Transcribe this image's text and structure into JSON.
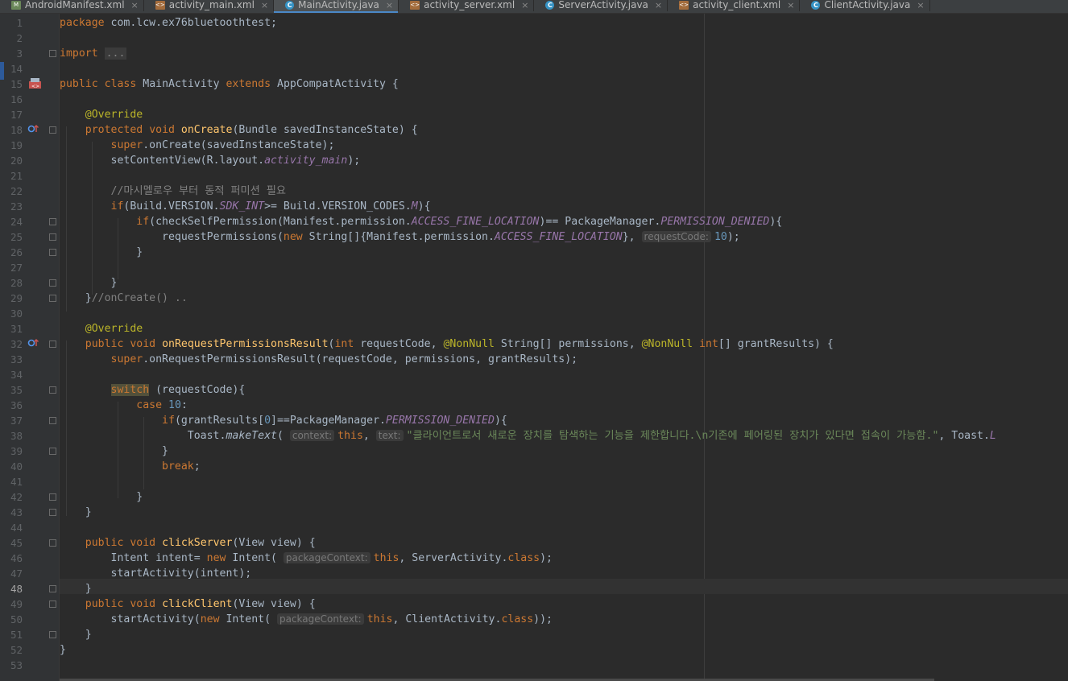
{
  "tabs": [
    {
      "label": "AndroidManifest.xml",
      "icon": "manifest-file-icon",
      "active": false
    },
    {
      "label": "activity_main.xml",
      "icon": "xml-file-icon",
      "active": false
    },
    {
      "label": "MainActivity.java",
      "icon": "java-class-icon",
      "active": true
    },
    {
      "label": "activity_server.xml",
      "icon": "xml-file-icon",
      "active": false
    },
    {
      "label": "ServerActivity.java",
      "icon": "java-class-icon",
      "active": false
    },
    {
      "label": "activity_client.xml",
      "icon": "xml-file-icon",
      "active": false
    },
    {
      "label": "ClientActivity.java",
      "icon": "java-class-icon",
      "active": false
    }
  ],
  "tab_close_glyph": "×",
  "current_line": "48",
  "code": {
    "l1": {
      "kw": "package",
      "rest": " com.lcw.ex76bluetoothtest;"
    },
    "l3": {
      "kw": "import",
      "fold": "..."
    },
    "l15": {
      "kw1": "public",
      "kw2": "class",
      "name": "MainActivity",
      "kw3": "extends",
      "rest": "AppCompatActivity {"
    },
    "l17": {
      "ann": "@Override"
    },
    "l18": {
      "kw1": "protected",
      "kw2": "void",
      "fn": "onCreate",
      "rest": "(Bundle savedInstanceState) {"
    },
    "l19": {
      "kw": "super",
      "rest": ".onCreate(savedInstanceState);"
    },
    "l20": {
      "pre": "setContentView(R.layout.",
      "field": "activity_main",
      "post": ");"
    },
    "l22": {
      "comment": "//마시멜로우 부터 동적 퍼미션 필요"
    },
    "l23": {
      "kw": "if",
      "pre": "(Build.VERSION.",
      "field": "SDK_INT",
      "mid": ">= Build.VERSION_CODES.",
      "field2": "M",
      "post": "){"
    },
    "l24": {
      "kw": "if",
      "pre": "(checkSelfPermission(Manifest.permission.",
      "field": "ACCESS_FINE_LOCATION",
      "mid": ")== PackageManager.",
      "field2": "PERMISSION_DENIED",
      "post": "){"
    },
    "l25": {
      "pre": "requestPermissions(",
      "kw": "new",
      "mid": " String[]{Manifest.permission.",
      "field": "ACCESS_FINE_LOCATION",
      "mid2": "}, ",
      "hint": "requestCode:",
      "num": "10",
      "post": ");"
    },
    "l26": {
      "text": "}"
    },
    "l28": {
      "text": "}"
    },
    "l29": {
      "brace": "}",
      "comment": "//onCreate() .."
    },
    "l31": {
      "ann": "@Override"
    },
    "l32": {
      "kw1": "public",
      "kw2": "void",
      "fn": "onRequestPermissionsResult",
      "p1": "(",
      "kw3": "int",
      "p2": " requestCode, ",
      "ann1": "@NonNull",
      "p3": " String[] permissions, ",
      "ann2": "@NonNull",
      "kw4": "int",
      "p4": "[] grantResults) {"
    },
    "l33": {
      "kw": "super",
      "rest": ".onRequestPermissionsResult(requestCode, permissions, grantResults);"
    },
    "l35": {
      "kw": "switch",
      "rest": " (requestCode){"
    },
    "l36": {
      "kw": "case",
      "num": "10",
      "post": ":"
    },
    "l37": {
      "kw": "if",
      "pre": "(grantResults[",
      "num": "0",
      "mid": "]==PackageManager.",
      "field": "PERMISSION_DENIED",
      "post": "){"
    },
    "l38": {
      "pre": "Toast.",
      "fn": "makeText",
      "p1": "( ",
      "hint1": "context:",
      "kw": "this",
      "p2": ", ",
      "hint2": "text:",
      "str": "\"클라이언트로서 새로운 장치를 탐색하는 기능을 제한합니다.\\n기존에 페어링된 장치가 있다면 접속이 가능함.\"",
      "post": ", Toast.",
      "tail": "L"
    },
    "l39": {
      "text": "}"
    },
    "l40": {
      "kw": "break",
      "post": ";"
    },
    "l42": {
      "text": "}"
    },
    "l43": {
      "text": "}"
    },
    "l45": {
      "kw1": "public",
      "kw2": "void",
      "fn": "clickServer",
      "rest": "(View view) {"
    },
    "l46": {
      "pre": "Intent intent= ",
      "kw": "new",
      "mid": " Intent( ",
      "hint": "packageContext:",
      "kw2": "this",
      "mid2": ", ServerActivity.",
      "kw3": "class",
      "post": ");"
    },
    "l47": {
      "text": "startActivity(intent);"
    },
    "l48": {
      "text": "}"
    },
    "l49": {
      "kw1": "public",
      "kw2": "void",
      "fn": "clickClient",
      "rest": "(View view) {"
    },
    "l50": {
      "pre": "startActivity(",
      "kw": "new",
      "mid": " Intent( ",
      "hint": "packageContext:",
      "kw2": "this",
      "mid2": ", ClientActivity.",
      "kw3": "class",
      "post": "));"
    },
    "l51": {
      "text": "}"
    },
    "l52": {
      "text": "}"
    }
  },
  "line_numbers": [
    "1",
    "2",
    "3",
    "14",
    "15",
    "16",
    "17",
    "18",
    "19",
    "20",
    "21",
    "22",
    "23",
    "24",
    "25",
    "26",
    "27",
    "28",
    "29",
    "30",
    "31",
    "32",
    "33",
    "34",
    "35",
    "36",
    "37",
    "38",
    "39",
    "40",
    "41",
    "42",
    "43",
    "44",
    "45",
    "46",
    "47",
    "48",
    "49",
    "50",
    "51",
    "52",
    "53"
  ]
}
